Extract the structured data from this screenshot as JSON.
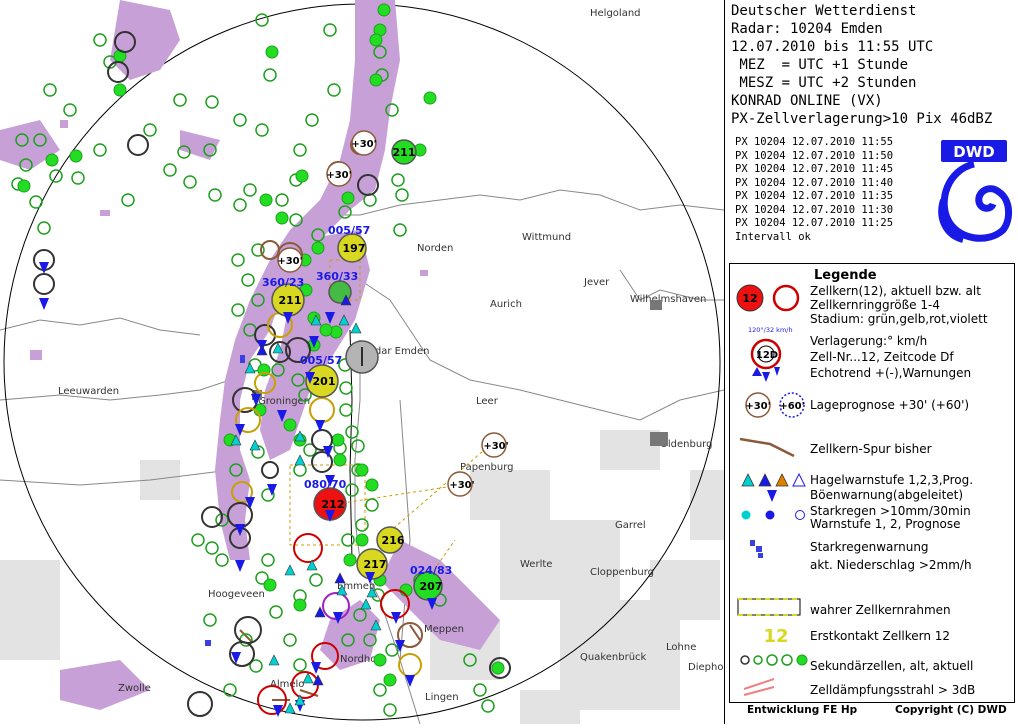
{
  "header": {
    "line1": "Deutscher Wetterdienst",
    "line2": "Radar: 10204 Emden",
    "line3": "12.07.2010 bis 11:55 UTC",
    "line4": " MEZ  = UTC +1 Stunde",
    "line5": " MESZ = UTC +2 Stunden",
    "line6": "KONRAD ONLINE (VX)",
    "line7": "PX-Zellverlagerung>10 Pix 46dBZ"
  },
  "scans": [
    "PX 10204 12.07.2010 11:55",
    "PX 10204 12.07.2010 11:50",
    "PX 10204 12.07.2010 11:45",
    "PX 10204 12.07.2010 11:40",
    "PX 10204 12.07.2010 11:35",
    "PX 10204 12.07.2010 11:30",
    "PX 10204 12.07.2010 11:25"
  ],
  "interval_status": "Intervall ok",
  "logo_text": "DWD",
  "legend": {
    "title": "Legende",
    "cellcore_line1": "Zellkern(12), aktuell bzw. alt",
    "cellcore_line2": "Zellkernringgröße 1-4",
    "cellcore_line3": "Stadium: grün,gelb,rot,violett",
    "sample_cell_no": "12",
    "move_sample_label": "120°/32 km/h",
    "move_sample_cell": "12D",
    "move_line1": "Verlagerung:° km/h",
    "move_line2": "Zell-Nr...12, Zeitcode Df",
    "move_line3": "Echotrend +(-),Warnungen",
    "forecast_30": "+30'",
    "forecast_60": "+60'",
    "forecast_text": "Lageprognose +30' (+60')",
    "track_text": "Zellkern-Spur bisher",
    "hail_text": "Hagelwarnstufe 1,2,3,Prog.",
    "gust_text": "Böenwarnung(abgeleitet)",
    "rain_line1": "Starkregen >10mm/30min",
    "rain_line2": "Warnstufe 1, 2, Prognose",
    "heavyrain_text": "Starkregenwarnung",
    "precip_text": "akt. Niederschlag >2mm/h",
    "frame_text": "wahrer Zellkernrahmen",
    "first_contact_no": "12",
    "first_contact_text": "Erstkontakt Zellkern 12",
    "secondary_text": "Sekundärzellen, alt, aktuell",
    "attenuation_text": "Zelldämpfungsstrahl > 3dB"
  },
  "footer": {
    "left": "Entwicklung FE Hp",
    "right": "Copyright (C) DWD"
  },
  "places": [
    {
      "name": "Helgoland"
    },
    {
      "name": "Norden"
    },
    {
      "name": "Wittmund"
    },
    {
      "name": "Jever"
    },
    {
      "name": "Aurich"
    },
    {
      "name": "Wilhelmshaven"
    },
    {
      "name": "Radar Emden"
    },
    {
      "name": "Leeuwarden"
    },
    {
      "name": "Groningen"
    },
    {
      "name": "Leer"
    },
    {
      "name": "Oldenburg"
    },
    {
      "name": "Papenburg"
    },
    {
      "name": "Garrel"
    },
    {
      "name": "Werlte"
    },
    {
      "name": "Cloppenburg"
    },
    {
      "name": "Hoogeveen"
    },
    {
      "name": "Emmen"
    },
    {
      "name": "Meppen"
    },
    {
      "name": "Lohne"
    },
    {
      "name": "Quakenbrück"
    },
    {
      "name": "Diepholz"
    },
    {
      "name": "Zwolle"
    },
    {
      "name": "Nordhorn"
    },
    {
      "name": "Almelo"
    },
    {
      "name": "Lingen"
    }
  ],
  "cells": [
    {
      "no": "211",
      "stage": "green"
    },
    {
      "no": "197",
      "stage": "yellow"
    },
    {
      "no": "211",
      "stage": "yellow"
    },
    {
      "no": "201",
      "stage": "yellow"
    },
    {
      "no": "212",
      "stage": "red"
    },
    {
      "no": "216",
      "stage": "yellow"
    },
    {
      "no": "217",
      "stage": "yellow"
    },
    {
      "no": "207",
      "stage": "green"
    }
  ],
  "movements": [
    "005/57",
    "360/23",
    "360/33",
    "005/57",
    "080/70",
    "024/83"
  ],
  "forecast_labels": [
    "+30'",
    "+30'",
    "+30'",
    "+30'",
    "+30'"
  ],
  "colors": {
    "precip": "#c8a0d8",
    "clutter": "#e2e2e2",
    "secondary_green": "#1ea01e",
    "cell_green": "#22dd22",
    "cell_yellow": "#d8d820",
    "cell_red": "#ee1111",
    "cell_violet": "#a020c0",
    "arrow_blue": "#1a1ae6",
    "hail_cyan": "#00d0d0"
  }
}
